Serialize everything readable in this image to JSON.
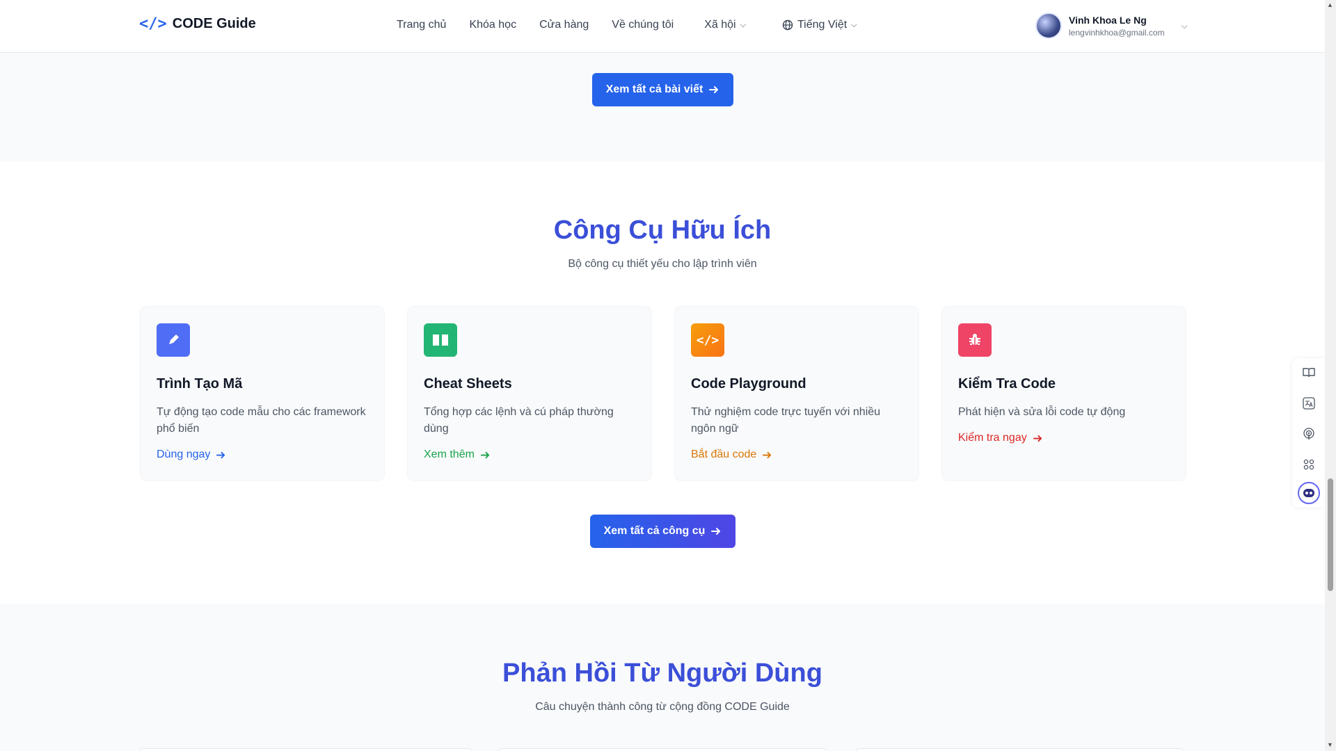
{
  "header": {
    "logo_icon": "</>",
    "logo_text": "CODE Guide",
    "nav": [
      {
        "label": "Trang chủ"
      },
      {
        "label": "Khóa học"
      },
      {
        "label": "Cửa hàng"
      },
      {
        "label": "Về chúng tôi"
      },
      {
        "label": "Xã hội"
      }
    ],
    "language": "Tiếng Việt",
    "user": {
      "name": "Vinh Khoa Le Ng",
      "email": "lengvinhkhoa@gmail.com"
    }
  },
  "posts_section": {
    "button_label": "Xem tất cả bài viết"
  },
  "tools_section": {
    "title": "Công Cụ Hữu Ích",
    "subtitle": "Bộ công cụ thiết yếu cho lập trình viên",
    "cards": [
      {
        "icon": "pencil-icon",
        "color": "#4f6df5",
        "title": "Trình Tạo Mã",
        "desc": "Tự động tạo code mẫu cho các framework phổ biến",
        "link": "Dùng ngay",
        "link_color": "#2563eb"
      },
      {
        "icon": "book-icon",
        "color": "#22b573",
        "title": "Cheat Sheets",
        "desc": "Tổng hợp các lệnh và cú pháp thường dùng",
        "link": "Xem thêm",
        "link_color": "#16a34a"
      },
      {
        "icon": "code-icon",
        "color": "#f59e0b",
        "title": "Code Playground",
        "desc": "Thử nghiệm code trực tuyến với nhiều ngôn ngữ",
        "link": "Bắt đầu code",
        "link_color": "#d97706"
      },
      {
        "icon": "bug-icon",
        "color": "#ef4466",
        "title": "Kiểm Tra Code",
        "desc": "Phát hiện và sửa lỗi code tự động",
        "link": "Kiểm tra ngay",
        "link_color": "#dc2626"
      }
    ],
    "button_label": "Xem tất cả công cụ"
  },
  "feedback_section": {
    "title": "Phản Hồi Từ Người Dùng",
    "subtitle": "Câu chuyện thành công từ cộng đồng CODE Guide"
  },
  "floating_tools": [
    "book-open-icon",
    "translate-icon",
    "podcast-icon",
    "apps-icon",
    "chatbot-icon"
  ]
}
